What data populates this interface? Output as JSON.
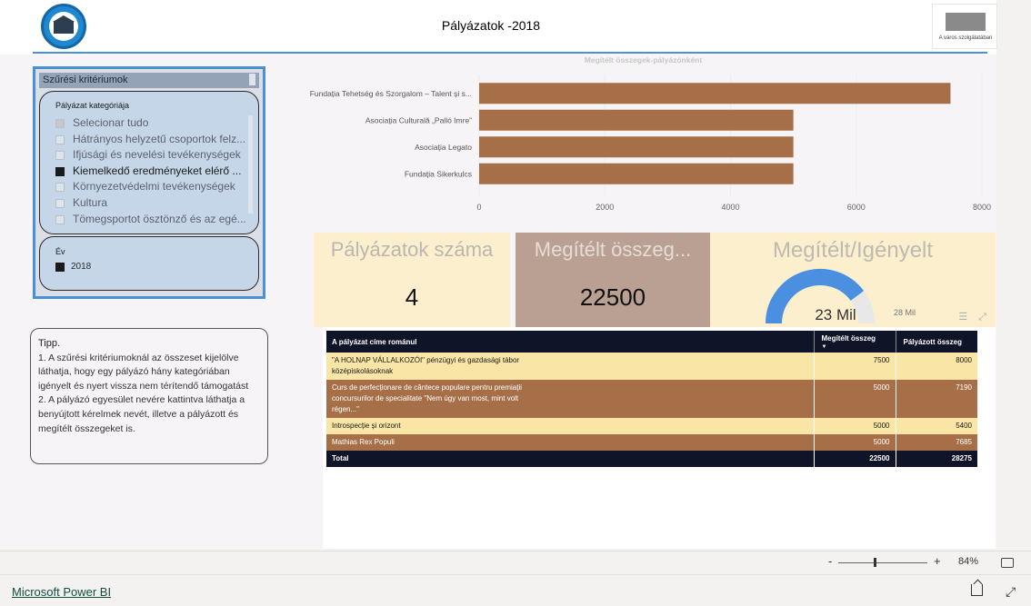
{
  "header": {
    "title": "Pályázatok -2018",
    "right_logo_caption": "A város szolgálatában"
  },
  "slicer": {
    "panel_title": "Szűrési kritériumok",
    "category_title": "Pályázat kategóriája",
    "categories": [
      {
        "label": "Selecionar tudo",
        "state": "partial"
      },
      {
        "label": "Hátrányos helyzetű csoportok felz...",
        "state": "unchecked"
      },
      {
        "label": "Ifjúsági és nevelési tevékenységek",
        "state": "unchecked"
      },
      {
        "label": "Kiemelkedő eredményeket elérő ...",
        "state": "checked"
      },
      {
        "label": "Környezetvédelmi tevékenységek",
        "state": "unchecked"
      },
      {
        "label": "Kultura",
        "state": "unchecked"
      },
      {
        "label": "Tömegsportot ösztönző és az egé...",
        "state": "unchecked"
      }
    ],
    "year_title": "Év",
    "year_value": "2018"
  },
  "tip": {
    "title": "Tipp.",
    "line1": "1. A szűrési kritériumoknál az összeset kijelölve láthatja, hogy egy pályázó hány kategóriában igényelt és nyert vissza nem térítendő támogatást",
    "line2": "2. A pályázó egyesület nevére kattintva láthatja a benyújtott kérelmek nevét, illetve a pályázott és megítélt összegeket is."
  },
  "chart_data": {
    "type": "bar",
    "orientation": "horizontal",
    "title": "Megítélt összegek-pályázónként",
    "categories": [
      "Fundația Tehetség és Szorgalom – Talent și s...",
      "Asociația Culturală „Palló Imre”",
      "Asociația Legato",
      "Fundația Sikerkulcs"
    ],
    "values": [
      7500,
      5000,
      5000,
      5000
    ],
    "xlim": [
      0,
      8000
    ],
    "xticks": [
      0,
      2000,
      4000,
      6000,
      8000
    ],
    "bar_color": "#a66f48",
    "grid": true
  },
  "kpis": {
    "count_label": "Pályázatok  száma",
    "count_value": "4",
    "amount_label": "Megítélt összeg...",
    "amount_value": "22500",
    "gauge_label": "Megítélt/Igényelt",
    "gauge_value_label": "23 Mil",
    "gauge_max_label": "28 Mil",
    "gauge_fraction": 0.796,
    "gauge_color": "#4a8fe0"
  },
  "table": {
    "headers": [
      "A pályázat címe románul",
      "Megítélt összeg",
      "Pályázott összeg"
    ],
    "rows": [
      {
        "title": "\"A HOLNAP VÁLLALKOZÓI\" pénzügyi és gazdasági tábor középiskolásoknak",
        "awarded": "7500",
        "requested": "8000",
        "style": "light"
      },
      {
        "title": "Curs de perfecționare de cântece populare pentru premiații concursurilor de specialitate \"Nem úgy van most, mint volt régen...\"",
        "awarded": "5000",
        "requested": "7190",
        "style": "dark"
      },
      {
        "title": "Introspecție și orizont",
        "awarded": "5000",
        "requested": "5400",
        "style": "light"
      },
      {
        "title": "Mathias Rex Populi",
        "awarded": "5000",
        "requested": "7685",
        "style": "dark"
      }
    ],
    "total": {
      "label": "Total",
      "awarded": "22500",
      "requested": "28275"
    }
  },
  "zoom": {
    "minus": "-",
    "plus": "+",
    "percent": "84%",
    "level": 0.84
  },
  "footer": {
    "link": "Microsoft Power BI"
  }
}
